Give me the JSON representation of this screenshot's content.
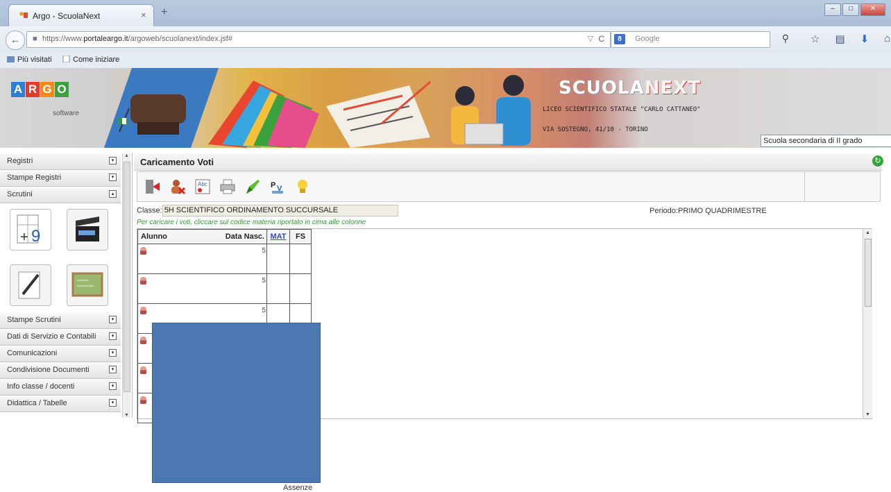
{
  "browser": {
    "tab_title": "Argo - ScuolaNext",
    "tab_close": "×",
    "new_tab": "+",
    "url_prefix": "https://www.",
    "url_domain": "portaleargo.it",
    "url_path": "/argoweb/scuolanext/index.jsf#",
    "search_placeholder": "Google",
    "bookmarks": [
      "Più visitati",
      "Come iniziare"
    ]
  },
  "banner": {
    "logo_letters": [
      "A",
      "R",
      "G",
      "O"
    ],
    "logo_sub": "software",
    "brand_a": "SCUOLA",
    "brand_b": "NEXT",
    "school_name": "LICEO SCIENTIFICO STATALE \"CARLO CATTANEO\"",
    "school_address": "VIA SOSTEGNO, 41/10 - TORINO",
    "school_type": "Scuola secondaria di II grado"
  },
  "sidebar": {
    "items_top": [
      "Registri",
      "Stampe Registri",
      "Scrutini"
    ],
    "items_bottom": [
      "Stampe Scrutini",
      "Dati di Servizio e Contabili",
      "Comunicazioni",
      "Condivisione Documenti",
      "Info classe / docenti",
      "Didattica / Tabelle"
    ]
  },
  "main": {
    "title": "Caricamento Voti",
    "classe_label": "Classe:",
    "classe_value": "5H SCIENTIFICO ORDINAMENTO SUCCURSALE",
    "periodo_label": "Periodo:",
    "periodo_value": "PRIMO QUADRIMESTRE",
    "hint": "Per caricare i voti, cliccare sul codice materia riportato in cima alle colonne",
    "columns": {
      "alunno": "Alunno",
      "data_nasc": "Data Nasc.",
      "mat": "MAT",
      "fs": "FS"
    },
    "row_count": 6,
    "row_digit": "5",
    "footer": "Assenze"
  },
  "colors": {
    "logo_boxes": [
      "#2d7fd0",
      "#e23a2c",
      "#f08a1a",
      "#3aa13c"
    ],
    "redaction": "#4c78b2",
    "hint_green": "#2f9a2f"
  },
  "icons": [
    "logout-icon",
    "user-remove-icon",
    "spellcheck-icon",
    "printer-icon",
    "pencil-green-icon",
    "pv-icon",
    "lightbulb-icon"
  ]
}
